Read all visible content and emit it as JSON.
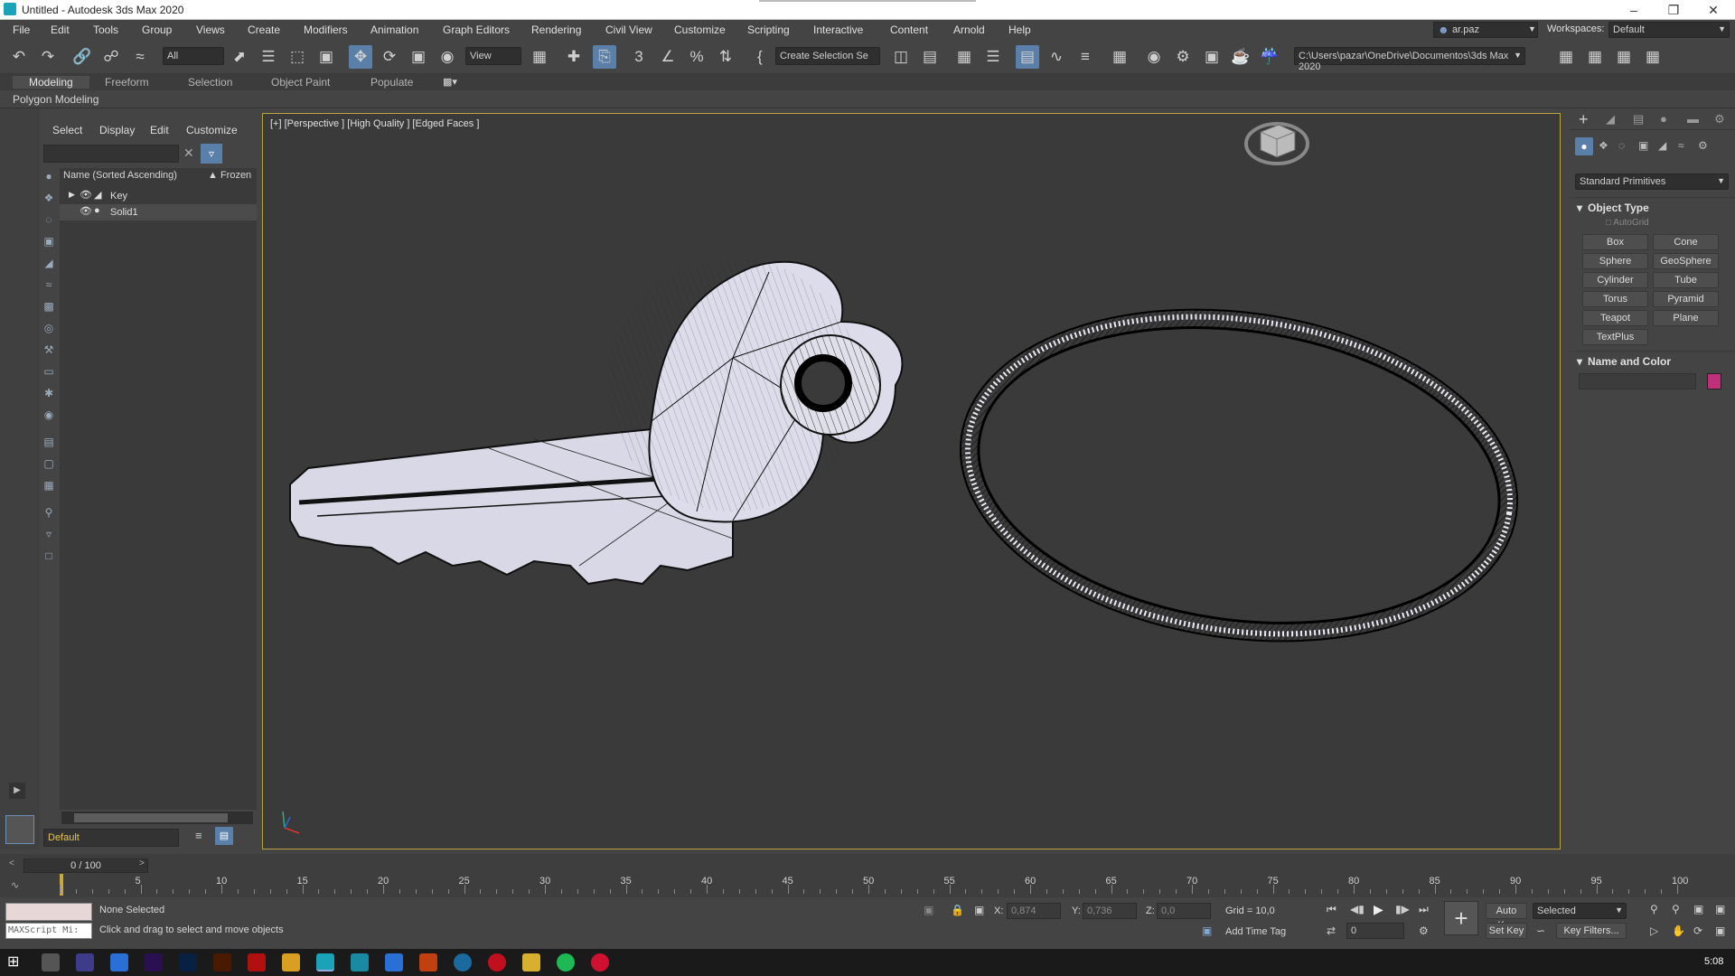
{
  "window": {
    "title": "Untitled - Autodesk 3ds Max 2020"
  },
  "menu": [
    "File",
    "Edit",
    "Tools",
    "Group",
    "Views",
    "Create",
    "Modifiers",
    "Animation",
    "Graph Editors",
    "Rendering",
    "Civil View",
    "Customize",
    "Scripting",
    "Interactive",
    "Content",
    "Arnold",
    "Help"
  ],
  "user": {
    "name": "ar.paz"
  },
  "workspace": {
    "label": "Workspaces:",
    "value": "Default"
  },
  "toolbar": {
    "filter_value": "All",
    "refcoord_value": "View",
    "selection_set_placeholder": "Create Selection Se",
    "project_path": "C:\\Users\\pazar\\OneDrive\\Documentos\\3ds Max 2020"
  },
  "ribbon": {
    "tabs": [
      "Modeling",
      "Freeform",
      "Selection",
      "Object Paint",
      "Populate"
    ],
    "active": "Modeling",
    "sub": "Polygon Modeling"
  },
  "scene_explorer": {
    "tabs": [
      "Select",
      "Display",
      "Edit",
      "Customize"
    ],
    "column_name": "Name (Sorted Ascending)",
    "column_frozen": "▲ Frozen",
    "items": [
      {
        "label": "Key"
      },
      {
        "label": "Solid1"
      }
    ],
    "layer": "Default"
  },
  "viewport": {
    "label": "[+] [Perspective ] [High Quality ] [Edged Faces ]"
  },
  "command_panel": {
    "dropdown": "Standard Primitives",
    "object_type_title": "Object Type",
    "autogrid": "AutoGrid",
    "buttons": [
      "Box",
      "Cone",
      "Sphere",
      "GeoSphere",
      "Cylinder",
      "Tube",
      "Torus",
      "Pyramid",
      "Teapot",
      "Plane",
      "TextPlus"
    ],
    "name_color_title": "Name and Color",
    "color": "#c0307a"
  },
  "timeline": {
    "frame": "0 / 100",
    "ticks": [
      "5",
      "10",
      "15",
      "20",
      "25",
      "30",
      "35",
      "40",
      "45",
      "50",
      "55",
      "60",
      "65",
      "70",
      "75",
      "80",
      "85",
      "90",
      "95",
      "100"
    ]
  },
  "status": {
    "maxscript": "MAXScript Mi:",
    "selection": "None Selected",
    "prompt": "Click and drag to select and move objects",
    "x_label": "X:",
    "x_value": "0,874",
    "y_label": "Y:",
    "y_value": "0,736",
    "z_label": "Z:",
    "z_value": "0,0",
    "grid": "Grid = 10,0",
    "add_time_tag": "Add Time Tag",
    "auto_key": "Auto Key",
    "set_key": "Set Key",
    "key_mode_value": "Selected",
    "key_filters": "Key Filters...",
    "frame_field": "0"
  },
  "taskbar": {
    "time": "5:08"
  }
}
